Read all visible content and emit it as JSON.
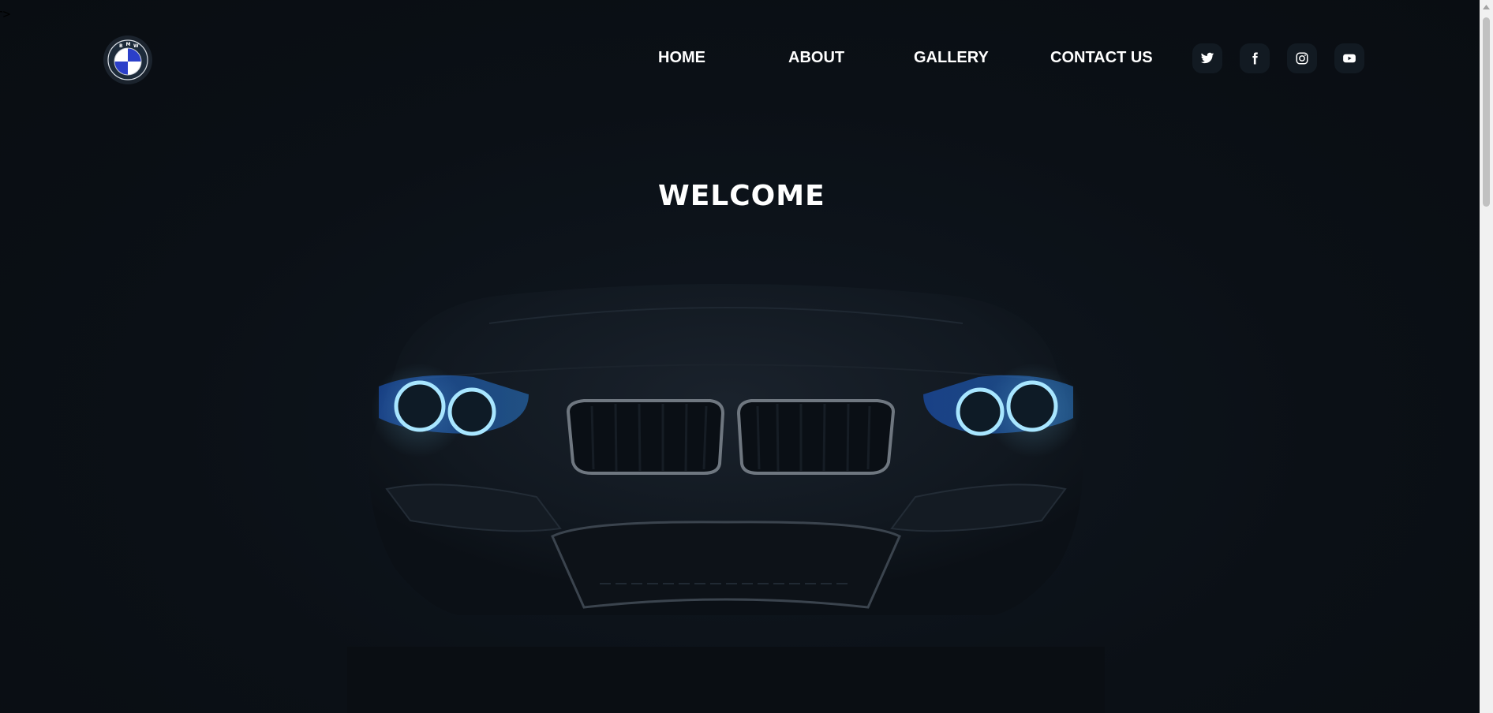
{
  "stray_text": "r>",
  "logo": {
    "icon": "bmw-logo-icon",
    "letters": [
      "B",
      "M",
      "W"
    ],
    "colors": {
      "blue": "#2b3fc9",
      "white": "#ffffff",
      "ring": "#1d2b3a"
    }
  },
  "nav": {
    "items": [
      {
        "label": "HOME"
      },
      {
        "label": "ABOUT"
      },
      {
        "label": "GALLERY"
      },
      {
        "label": "CONTACT US"
      }
    ]
  },
  "social": [
    {
      "icon": "twitter-icon"
    },
    {
      "icon": "facebook-icon"
    },
    {
      "icon": "instagram-icon"
    },
    {
      "icon": "youtube-icon"
    }
  ],
  "hero": {
    "title": "WELCOME",
    "image": "car-front-icon",
    "colors": {
      "headlight": "#7fd6ff",
      "background": "#0b1016"
    }
  }
}
